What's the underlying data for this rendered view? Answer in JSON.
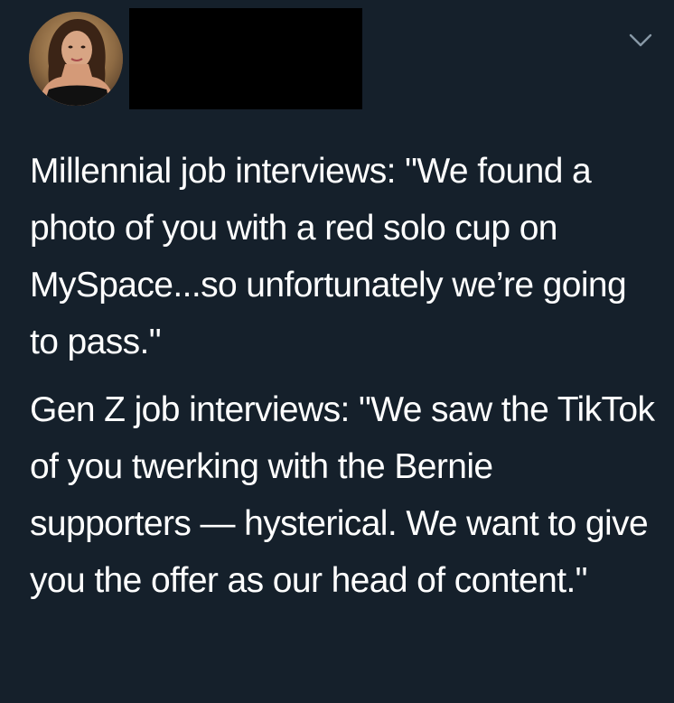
{
  "tweet": {
    "author_avatar_icon": "avatar-photo",
    "menu_icon": "chevron-down-icon",
    "paragraphs": [
      "Millennial job interviews: \"We found a photo of you with a red solo cup on MySpace...so unfortunately we’re going to pass.\"",
      "Gen Z job interviews: \"We saw the TikTok of you twerking with the Bernie supporters — hysterical. We want to give you the offer as our head of content.\""
    ]
  },
  "colors": {
    "background": "#15202b",
    "text": "#ffffff",
    "chevron": "#8899a6",
    "redaction": "#000000"
  }
}
